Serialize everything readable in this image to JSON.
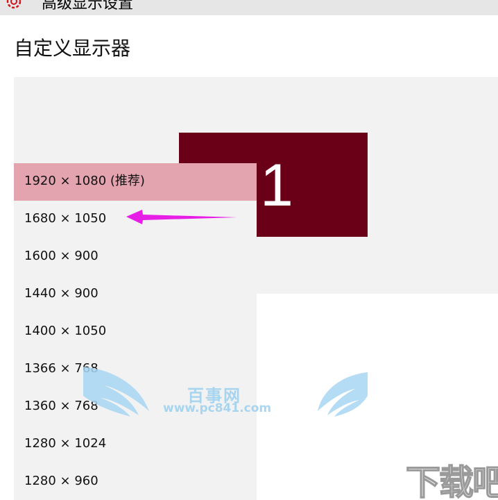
{
  "titlebar": {
    "title": "高级显示设置",
    "icon": "gear-icon"
  },
  "page": {
    "title": "自定义显示器"
  },
  "display": {
    "monitor_number": "1",
    "monitor_color": "#6a0017"
  },
  "resolution_list": {
    "selected_index": 0,
    "selected_color": "#e3a4b0",
    "items": [
      {
        "label": "1920 × 1080 (推荐)"
      },
      {
        "label": "1680 × 1050"
      },
      {
        "label": "1600 × 900"
      },
      {
        "label": "1440 × 900"
      },
      {
        "label": "1400 × 1050"
      },
      {
        "label": "1366 × 768"
      },
      {
        "label": "1360 × 768"
      },
      {
        "label": "1280 × 1024"
      },
      {
        "label": "1280 × 960"
      }
    ]
  },
  "annotation": {
    "arrow_color": "#e61ee6"
  },
  "watermark": {
    "brand": "百事网",
    "url": "www.pc841.com",
    "corner_logo": "下载吧"
  }
}
